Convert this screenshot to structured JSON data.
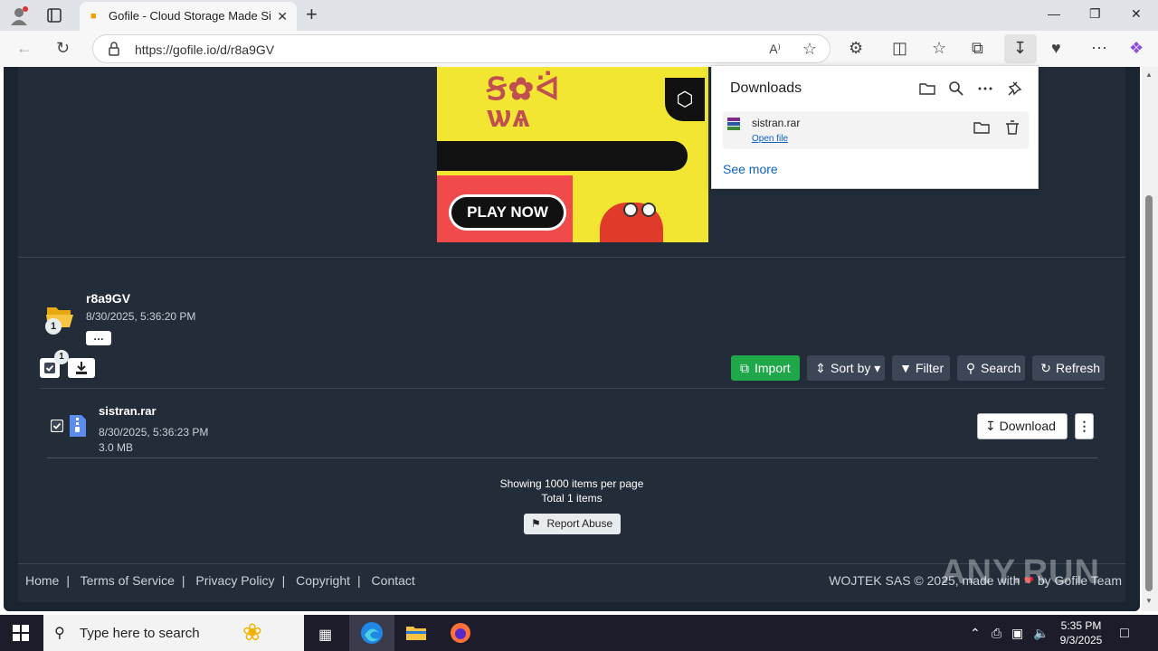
{
  "browser": {
    "tab_title": "Gofile - Cloud Storage Made Simple",
    "url": "https://gofile.io/d/r8a9GV",
    "read_aloud": "A⁾"
  },
  "downloads_panel": {
    "title": "Downloads",
    "item": {
      "filename": "sistran.rar",
      "action": "Open file"
    },
    "see_more": "See more"
  },
  "ad": {
    "cta": "PLAY NOW"
  },
  "folder": {
    "name": "r8a9GV",
    "date": "8/30/2025, 5:36:20 PM",
    "count": "1",
    "more_label": "…"
  },
  "toolbar": {
    "selected_count": "1",
    "import": "Import",
    "sort_by": "Sort by",
    "filter": "Filter",
    "search": "Search",
    "refresh": "Refresh"
  },
  "files": [
    {
      "name": "sistran.rar",
      "date": "8/30/2025, 5:36:23 PM",
      "size": "3.0 MB",
      "download": "Download"
    }
  ],
  "pagination": {
    "showing": "Showing 1000 items per page",
    "total": "Total 1 items",
    "report": "Report Abuse"
  },
  "footer": {
    "links": [
      "Home",
      "Terms of Service",
      "Privacy Policy",
      "Copyright",
      "Contact"
    ],
    "right_prefix": "WOJTEK SAS © 2025, made with",
    "right_suffix": "by Gofile Team"
  },
  "taskbar": {
    "search_placeholder": "Type here to search",
    "time": "5:35 PM",
    "date": "9/3/2025"
  },
  "watermark": "ANY.RUN",
  "colors": {
    "page_bg": "#232d3a",
    "accent_green": "#1fa84a",
    "button_dark": "#3c4656",
    "link_blue": "#0f62c5"
  }
}
